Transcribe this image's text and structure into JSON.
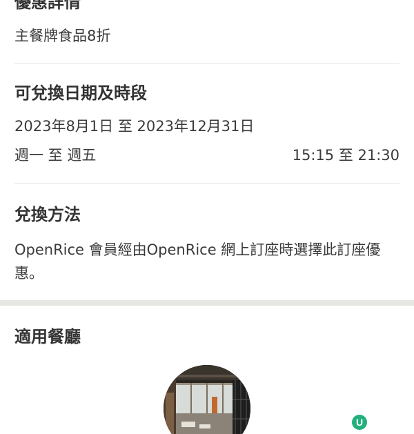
{
  "offer_details": {
    "title": "優惠詳情",
    "description": "主餐牌食品8折"
  },
  "redeem_period": {
    "title": "可兌換日期及時段",
    "date_range": "2023年8月1日 至 2023年12月31日",
    "days": "週一 至 週五",
    "time_range": "15:15 至 21:30"
  },
  "redeem_method": {
    "title": "兌換方法",
    "description": "OpenRice 會員經由OpenRice 網上訂座時選擇此訂座優惠。"
  },
  "applicable_restaurants": {
    "title": "適用餐廳"
  },
  "watermark": {
    "letter": "U",
    "icon": "brand-logo-icon",
    "color": "#22b07d"
  }
}
